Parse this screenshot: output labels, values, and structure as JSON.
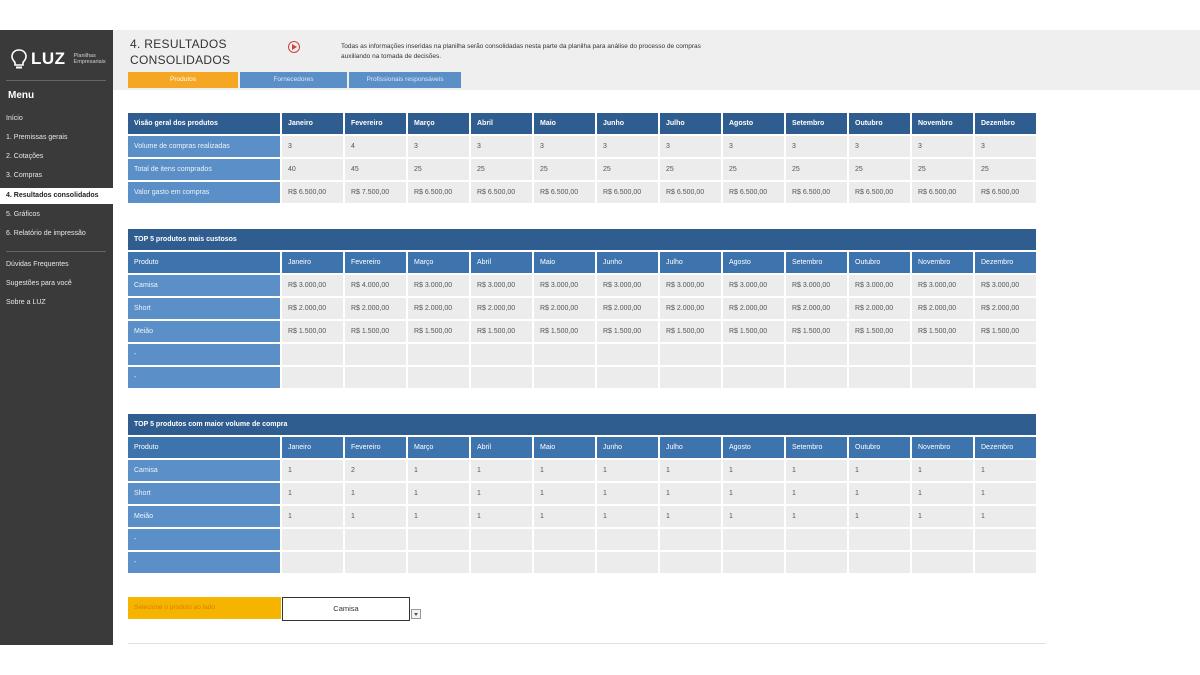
{
  "sidebar": {
    "brand": "LUZ",
    "tagline_1": "Planilhas",
    "tagline_2": "Empresariais",
    "menu_title": "Menu",
    "items": [
      {
        "label": "Início"
      },
      {
        "label": "1. Premissas gerais"
      },
      {
        "label": "2. Cotações"
      },
      {
        "label": "3. Compras"
      },
      {
        "label": "4. Resultados consolidados"
      },
      {
        "label": "5. Gráficos"
      },
      {
        "label": "6. Relatório de impressão"
      }
    ],
    "extra_items": [
      {
        "label": "Dúvidas Frequentes"
      },
      {
        "label": "Sugestões para você"
      },
      {
        "label": "Sobre a LUZ"
      }
    ]
  },
  "header": {
    "title_line1": "4. RESULTADOS",
    "title_line2": "CONSOLIDADOS",
    "description": "Todas as informações inseridas na planilha serão consolidadas nesta parte da planilha para análise do processo de compras auxiliando na tomada de decisões.",
    "tabs": [
      {
        "label": "Produtos"
      },
      {
        "label": "Fornecedores"
      },
      {
        "label": "Profissionais responsáveis"
      }
    ]
  },
  "months": [
    "Janeiro",
    "Fevereiro",
    "Março",
    "Abril",
    "Maio",
    "Junho",
    "Julho",
    "Agosto",
    "Setembro",
    "Outubro",
    "Novembro",
    "Dezembro"
  ],
  "overview": {
    "header": "Visão geral dos produtos",
    "rows": [
      {
        "label": "Volume de compras realizadas",
        "values": [
          "3",
          "4",
          "3",
          "3",
          "3",
          "3",
          "3",
          "3",
          "3",
          "3",
          "3",
          "3"
        ]
      },
      {
        "label": "Total de itens comprados",
        "values": [
          "40",
          "45",
          "25",
          "25",
          "25",
          "25",
          "25",
          "25",
          "25",
          "25",
          "25",
          "25"
        ]
      },
      {
        "label": "Valor gasto em compras",
        "values": [
          "R$ 6.500,00",
          "R$ 7.500,00",
          "R$ 6.500,00",
          "R$ 6.500,00",
          "R$ 6.500,00",
          "R$ 6.500,00",
          "R$ 6.500,00",
          "R$ 6.500,00",
          "R$ 6.500,00",
          "R$ 6.500,00",
          "R$ 6.500,00",
          "R$ 6.500,00"
        ]
      }
    ]
  },
  "top_costly": {
    "title": "TOP 5 produtos mais custosos",
    "col_header": "Produto",
    "rows": [
      {
        "label": "Camisa",
        "values": [
          "R$ 3.000,00",
          "R$ 4.000,00",
          "R$ 3.000,00",
          "R$ 3.000,00",
          "R$ 3.000,00",
          "R$ 3.000,00",
          "R$ 3.000,00",
          "R$ 3.000,00",
          "R$ 3.000,00",
          "R$ 3.000,00",
          "R$ 3.000,00",
          "R$ 3.000,00"
        ]
      },
      {
        "label": "Short",
        "values": [
          "R$ 2.000,00",
          "R$ 2.000,00",
          "R$ 2.000,00",
          "R$ 2.000,00",
          "R$ 2.000,00",
          "R$ 2.000,00",
          "R$ 2.000,00",
          "R$ 2.000,00",
          "R$ 2.000,00",
          "R$ 2.000,00",
          "R$ 2.000,00",
          "R$ 2.000,00"
        ]
      },
      {
        "label": "Meião",
        "values": [
          "R$ 1.500,00",
          "R$ 1.500,00",
          "R$ 1.500,00",
          "R$ 1.500,00",
          "R$ 1.500,00",
          "R$ 1.500,00",
          "R$ 1.500,00",
          "R$ 1.500,00",
          "R$ 1.500,00",
          "R$ 1.500,00",
          "R$ 1.500,00",
          "R$ 1.500,00"
        ]
      },
      {
        "label": "-",
        "values": [
          "",
          "",
          "",
          "",
          "",
          "",
          "",
          "",
          "",
          "",
          "",
          ""
        ]
      },
      {
        "label": "-",
        "values": [
          "",
          "",
          "",
          "",
          "",
          "",
          "",
          "",
          "",
          "",
          "",
          ""
        ]
      }
    ]
  },
  "top_volume": {
    "title": "TOP 5 produtos com maior volume de compra",
    "col_header": "Produto",
    "rows": [
      {
        "label": "Camisa",
        "values": [
          "1",
          "2",
          "1",
          "1",
          "1",
          "1",
          "1",
          "1",
          "1",
          "1",
          "1",
          "1"
        ]
      },
      {
        "label": "Short",
        "values": [
          "1",
          "1",
          "1",
          "1",
          "1",
          "1",
          "1",
          "1",
          "1",
          "1",
          "1",
          "1"
        ]
      },
      {
        "label": "Meião",
        "values": [
          "1",
          "1",
          "1",
          "1",
          "1",
          "1",
          "1",
          "1",
          "1",
          "1",
          "1",
          "1"
        ]
      },
      {
        "label": "-",
        "values": [
          "",
          "",
          "",
          "",
          "",
          "",
          "",
          "",
          "",
          "",
          "",
          ""
        ]
      },
      {
        "label": "-",
        "values": [
          "",
          "",
          "",
          "",
          "",
          "",
          "",
          "",
          "",
          "",
          "",
          ""
        ]
      }
    ]
  },
  "selector": {
    "label": "Selecione o produto ao lado",
    "value": "Camisa"
  }
}
